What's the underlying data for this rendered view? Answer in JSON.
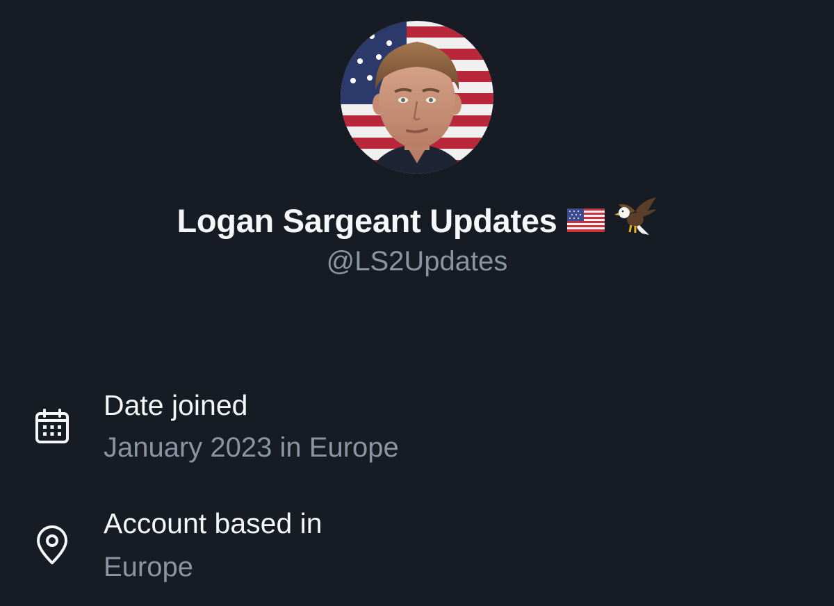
{
  "profile": {
    "display_name": "Logan Sargeant Updates",
    "name_badges": [
      "us-flag-icon",
      "eagle-icon"
    ],
    "handle": "@LS2Updates",
    "avatar": "profile-avatar"
  },
  "about": {
    "items": [
      {
        "icon": "calendar-icon",
        "label": "Date joined",
        "value": "January 2023 in Europe"
      },
      {
        "icon": "location-pin-icon",
        "label": "Account based in",
        "value": "Europe"
      }
    ]
  },
  "colors": {
    "background": "#171c24",
    "primary_text": "#f5f7f9",
    "secondary_text": "#8b95a2"
  }
}
